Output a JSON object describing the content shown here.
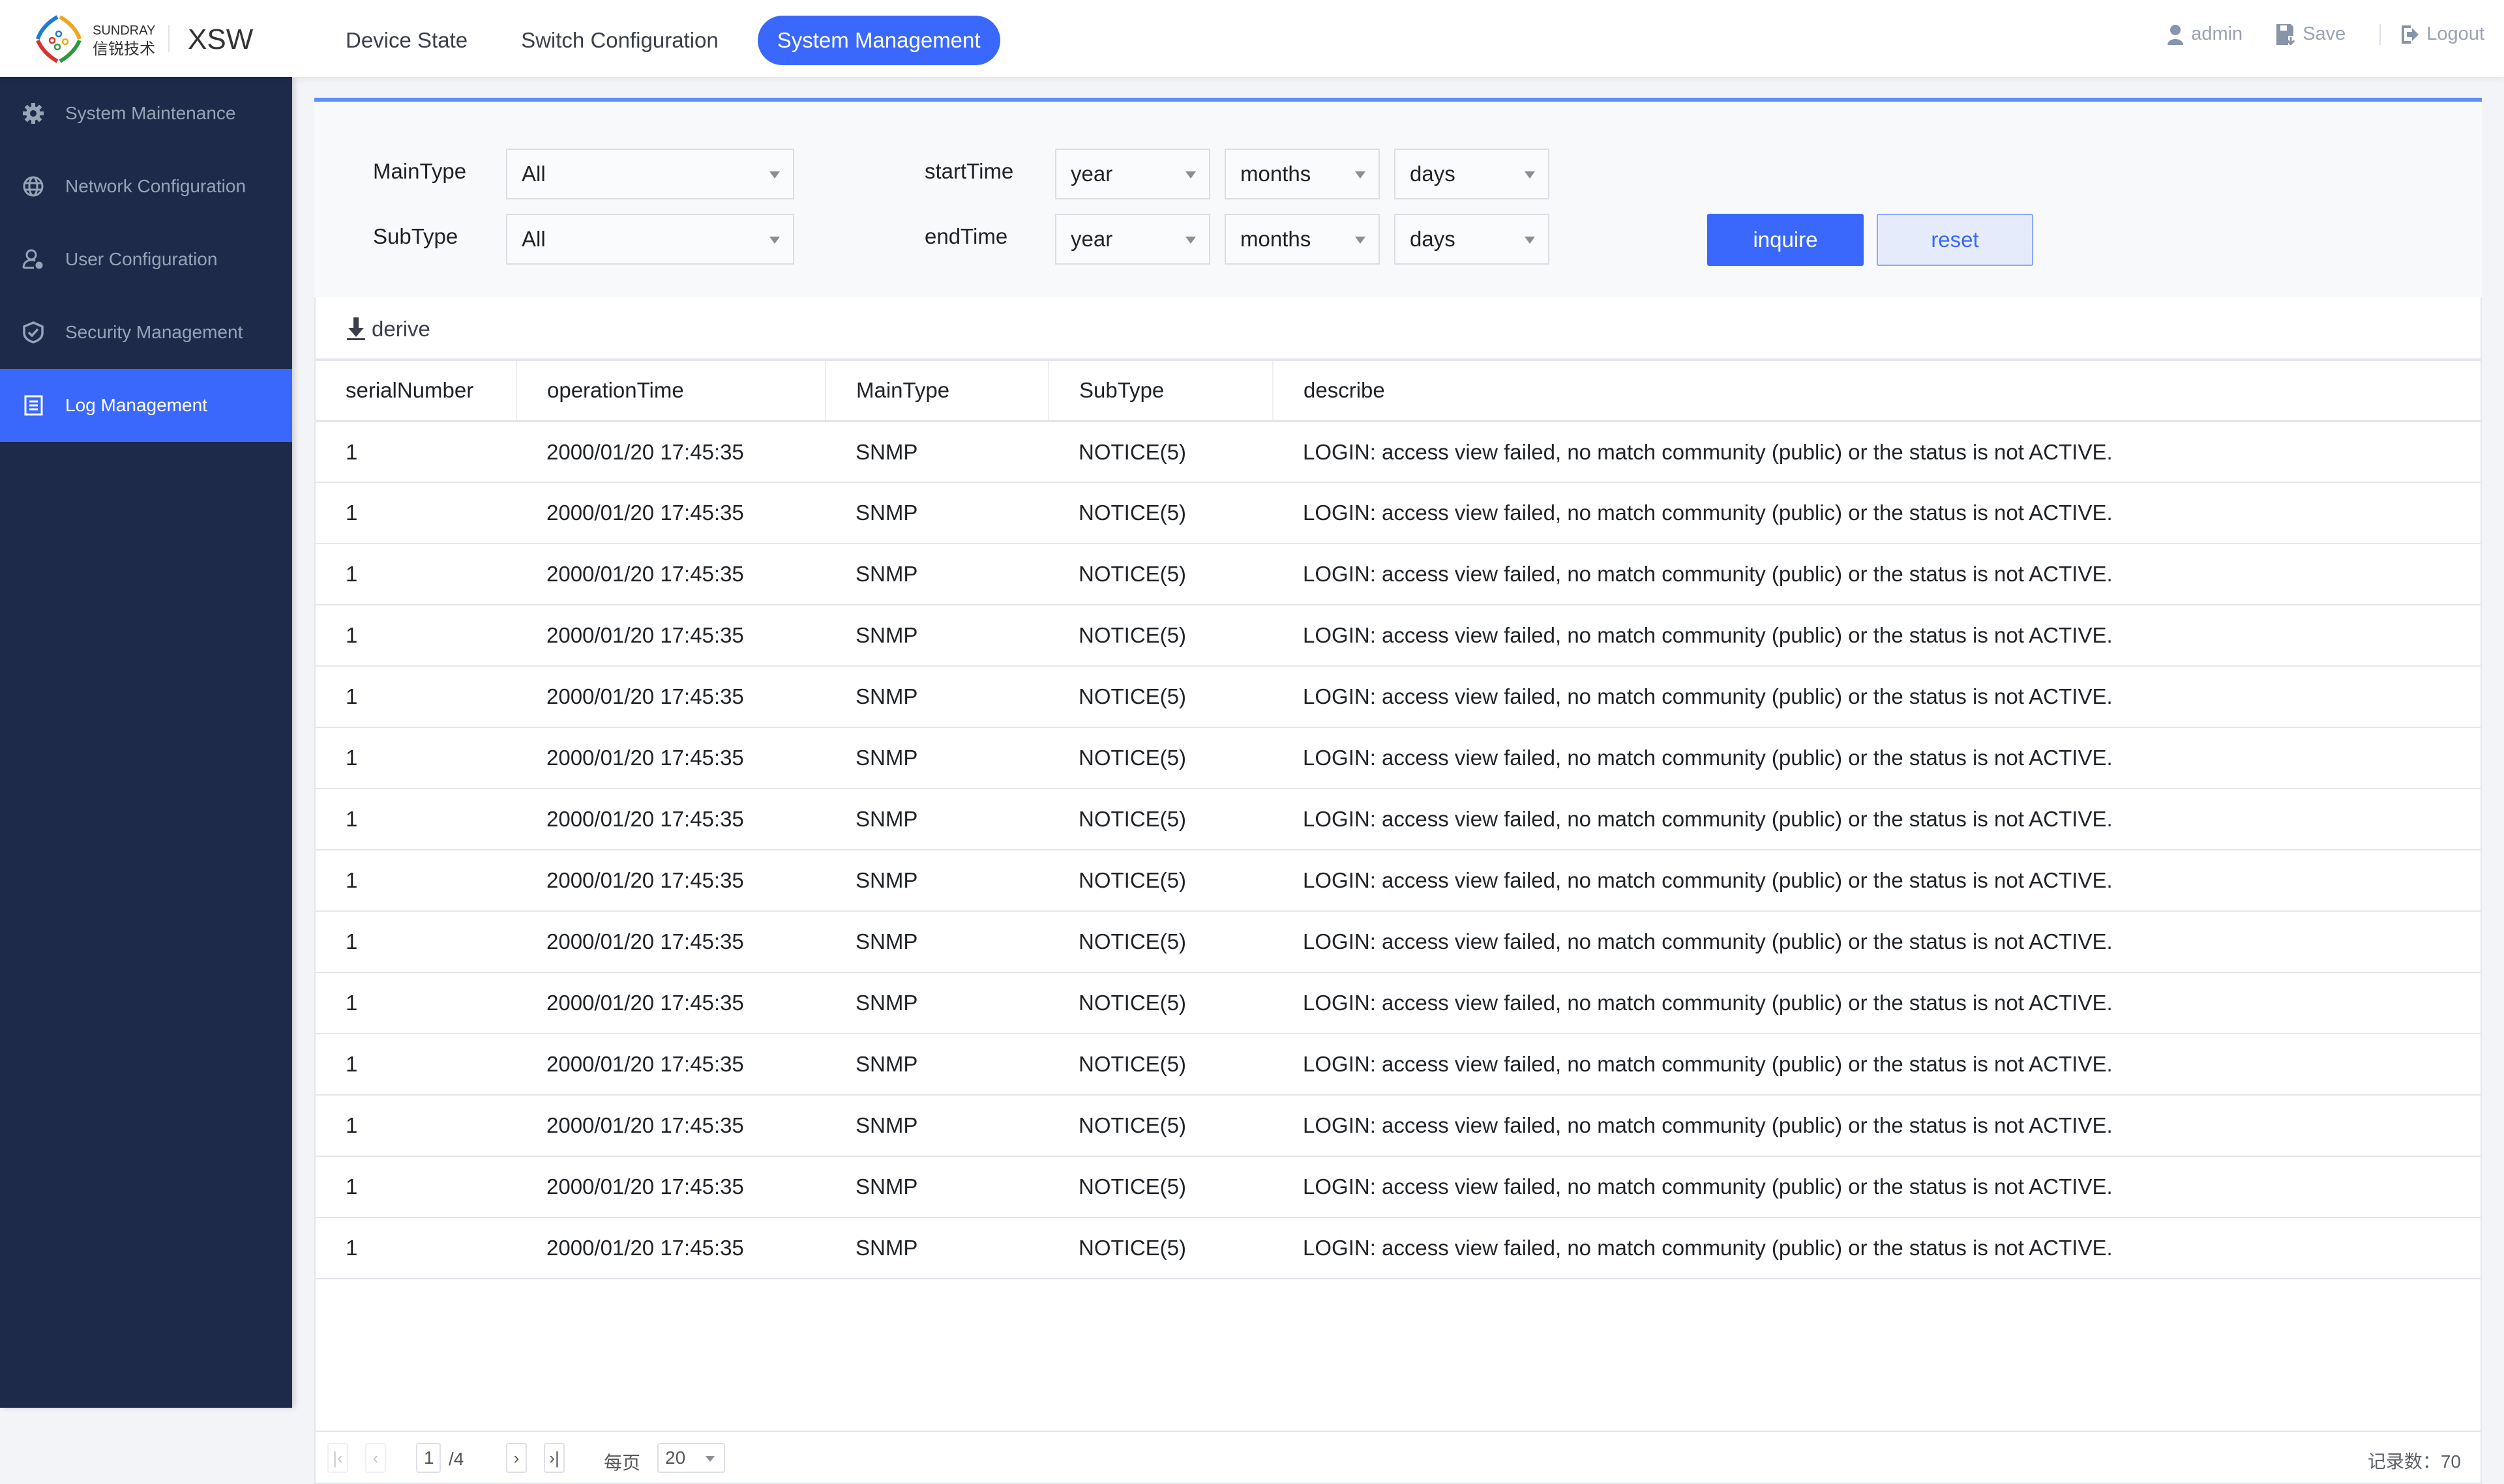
{
  "brand": {
    "name_en": "SUNDRAY",
    "name_cn": "信锐技术",
    "product": "XSW"
  },
  "nav": {
    "tabs": [
      {
        "label": "Device State",
        "active": false
      },
      {
        "label": "Switch Configuration",
        "active": false
      },
      {
        "label": "System Management",
        "active": true
      }
    ]
  },
  "topright": {
    "user": "admin",
    "save": "Save",
    "logout": "Logout"
  },
  "sidebar": {
    "items": [
      {
        "label": "System Maintenance",
        "icon": "gear-icon",
        "active": false
      },
      {
        "label": "Network Configuration",
        "icon": "globe-icon",
        "active": false
      },
      {
        "label": "User Configuration",
        "icon": "user-gear-icon",
        "active": false
      },
      {
        "label": "Security Management",
        "icon": "shield-check-icon",
        "active": false
      },
      {
        "label": "Log Management",
        "icon": "log-list-icon",
        "active": true
      }
    ]
  },
  "filter": {
    "maintype_label": "MainType",
    "maintype_value": "All",
    "subtype_label": "SubType",
    "subtype_value": "All",
    "starttime_label": "startTime",
    "endtime_label": "endTime",
    "start": {
      "year": "year",
      "month": "months",
      "day": "days"
    },
    "end": {
      "year": "year",
      "month": "months",
      "day": "days"
    },
    "inquire": "inquire",
    "reset": "reset"
  },
  "toolbar": {
    "derive": "derive"
  },
  "table": {
    "columns": [
      "serialNumber",
      "operationTime",
      "MainType",
      "SubType",
      "describe"
    ],
    "rows": [
      [
        "1",
        "2000/01/20 17:45:35",
        "SNMP",
        "NOTICE(5)",
        "LOGIN: access view failed, no match community (public) or the status is not ACTIVE."
      ],
      [
        "1",
        "2000/01/20 17:45:35",
        "SNMP",
        "NOTICE(5)",
        "LOGIN: access view failed, no match community (public) or the status is not ACTIVE."
      ],
      [
        "1",
        "2000/01/20 17:45:35",
        "SNMP",
        "NOTICE(5)",
        "LOGIN: access view failed, no match community (public) or the status is not ACTIVE."
      ],
      [
        "1",
        "2000/01/20 17:45:35",
        "SNMP",
        "NOTICE(5)",
        "LOGIN: access view failed, no match community (public) or the status is not ACTIVE."
      ],
      [
        "1",
        "2000/01/20 17:45:35",
        "SNMP",
        "NOTICE(5)",
        "LOGIN: access view failed, no match community (public) or the status is not ACTIVE."
      ],
      [
        "1",
        "2000/01/20 17:45:35",
        "SNMP",
        "NOTICE(5)",
        "LOGIN: access view failed, no match community (public) or the status is not ACTIVE."
      ],
      [
        "1",
        "2000/01/20 17:45:35",
        "SNMP",
        "NOTICE(5)",
        "LOGIN: access view failed, no match community (public) or the status is not ACTIVE."
      ],
      [
        "1",
        "2000/01/20 17:45:35",
        "SNMP",
        "NOTICE(5)",
        "LOGIN: access view failed, no match community (public) or the status is not ACTIVE."
      ],
      [
        "1",
        "2000/01/20 17:45:35",
        "SNMP",
        "NOTICE(5)",
        "LOGIN: access view failed, no match community (public) or the status is not ACTIVE."
      ],
      [
        "1",
        "2000/01/20 17:45:35",
        "SNMP",
        "NOTICE(5)",
        "LOGIN: access view failed, no match community (public) or the status is not ACTIVE."
      ],
      [
        "1",
        "2000/01/20 17:45:35",
        "SNMP",
        "NOTICE(5)",
        "LOGIN: access view failed, no match community (public) or the status is not ACTIVE."
      ],
      [
        "1",
        "2000/01/20 17:45:35",
        "SNMP",
        "NOTICE(5)",
        "LOGIN: access view failed, no match community (public) or the status is not ACTIVE."
      ],
      [
        "1",
        "2000/01/20 17:45:35",
        "SNMP",
        "NOTICE(5)",
        "LOGIN: access view failed, no match community (public) or the status is not ACTIVE."
      ],
      [
        "1",
        "2000/01/20 17:45:35",
        "SNMP",
        "NOTICE(5)",
        "LOGIN: access view failed, no match community (public) or the status is not ACTIVE."
      ]
    ]
  },
  "pagination": {
    "current_page": "1",
    "total_pages": "/4",
    "per_page_label": "每页",
    "per_page_value": "20",
    "records_label": "记录数：",
    "records_count": "70"
  },
  "colors": {
    "accent": "#3a68fd",
    "sidebar_bg": "#1e2a4a",
    "topline": "#5b8ff9"
  }
}
